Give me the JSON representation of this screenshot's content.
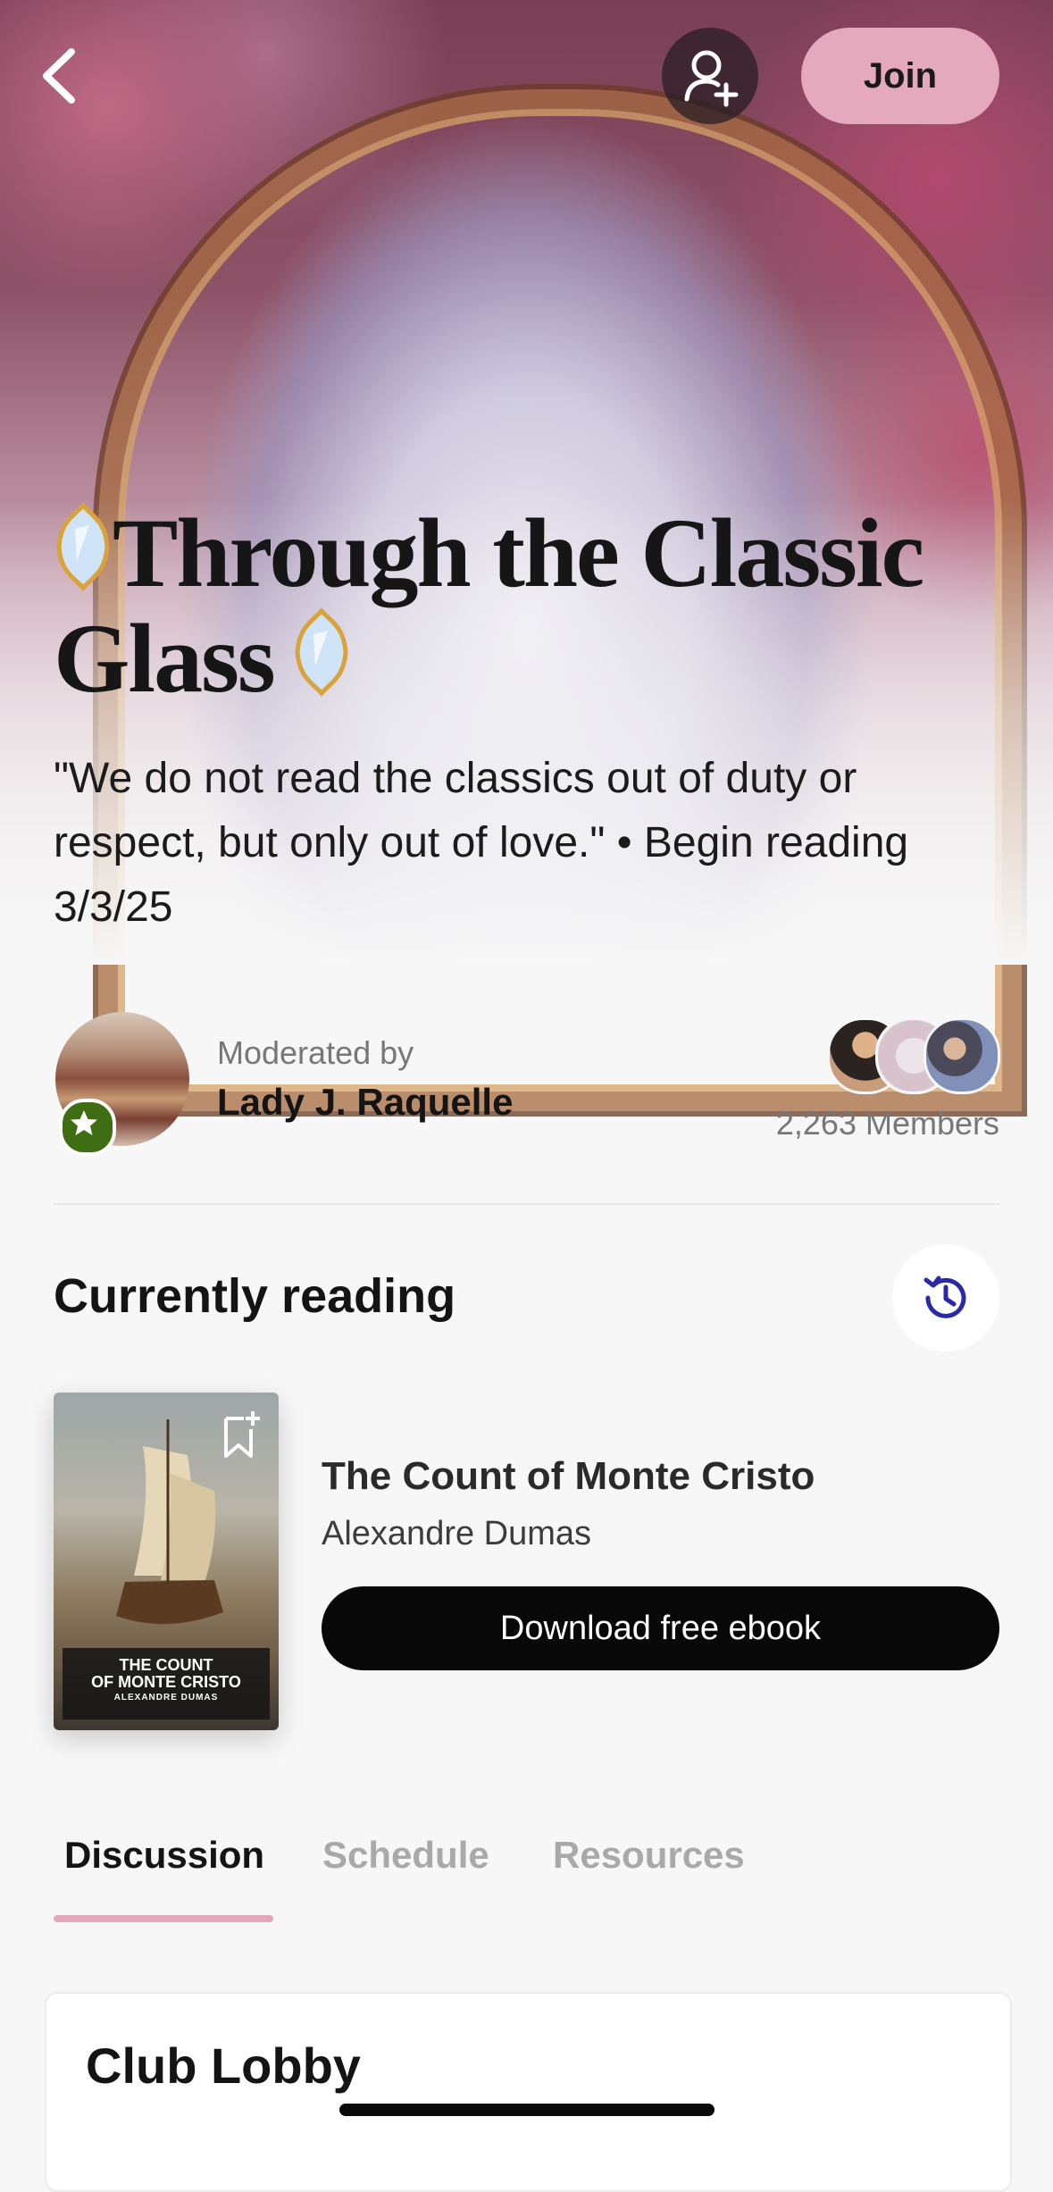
{
  "header": {
    "join_label": "Join"
  },
  "club": {
    "title": "Through the Classic Glass",
    "tagline": "\"We do not read the classics out of duty or respect, but only out of love.\" • Begin reading 3/3/25"
  },
  "moderator": {
    "label": "Moderated by",
    "name": "Lady J. Raquelle"
  },
  "members": {
    "count_text": "2,263 Members"
  },
  "currently_reading": {
    "section_title": "Currently reading",
    "book": {
      "title": "The Count of Monte Cristo",
      "author": "Alexandre Dumas",
      "cover_title_line1": "THE COUNT",
      "cover_title_line2": "OF MONTE CRISTO",
      "cover_author": "ALEXANDRE DUMAS"
    },
    "download_label": "Download free ebook"
  },
  "tabs": [
    {
      "label": "Discussion",
      "active": true
    },
    {
      "label": "Schedule",
      "active": false
    },
    {
      "label": "Resources",
      "active": false
    }
  ],
  "lobby": {
    "title": "Club Lobby"
  },
  "colors": {
    "accent_pink": "#e4a9bd",
    "history_icon": "#2a2aa8",
    "badge_green": "#3f6d13"
  }
}
